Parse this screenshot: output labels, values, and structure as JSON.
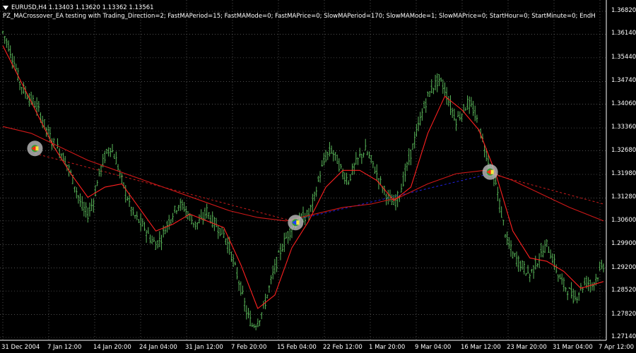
{
  "header": {
    "symbol_line": "EURUSD,H4  1.13403 1.13620 1.13362 1.13561",
    "ea_line": "PZ_MACrossover_EA testing with Trading_Direction=2; FastMAPeriod=15; FastMAMode=0; FastMAPrice=0; SlowMAPeriod=170; SlowMAMode=1; SlowMAPrice=0; StartHour=0; StartMinute=0; EndH"
  },
  "colors": {
    "background": "#000000",
    "grid": "#7f7f7f",
    "candles": "#59b659",
    "fast_ma": "#ff2020",
    "slow_ma": "#d01818",
    "trend_line_down": "#c81c1c",
    "trend_line_up": "#2020e0",
    "text": "#ffffff"
  },
  "chart_data": {
    "type": "candlestick",
    "symbol": "EURUSD",
    "timeframe": "H4",
    "last_ohlc": {
      "open": 1.13403,
      "high": 1.1362,
      "low": 1.13362,
      "close": 1.13561
    },
    "ylim": [
      1.27,
      1.369
    ],
    "y_ticks": [
      "1.36820",
      "1.36140",
      "1.35440",
      "1.34740",
      "1.34060",
      "1.33360",
      "1.32680",
      "1.31980",
      "1.31280",
      "1.30600",
      "1.29900",
      "1.29200",
      "1.28520",
      "1.27820",
      "1.27140"
    ],
    "x_ticks": [
      "31 Dec 2004",
      "7 Jan 12:00",
      "14 Jan 20:00",
      "24 Jan 04:00",
      "31 Jan 12:00",
      "7 Feb 20:00",
      "15 Feb 04:00",
      "22 Feb 12:00",
      "1 Mar 20:00",
      "9 Mar 04:00",
      "16 Mar 12:00",
      "23 Mar 20:00",
      "31 Mar 04:00",
      "7 Apr 12:00"
    ],
    "grid": true,
    "price_path": [
      [
        0,
        1.362
      ],
      [
        3,
        1.358
      ],
      [
        6,
        1.353
      ],
      [
        9,
        1.347
      ],
      [
        12,
        1.344
      ],
      [
        15,
        1.342
      ],
      [
        18,
        1.34
      ],
      [
        21,
        1.336
      ],
      [
        24,
        1.332
      ],
      [
        27,
        1.329
      ],
      [
        30,
        1.327
      ],
      [
        33,
        1.324
      ],
      [
        36,
        1.32
      ],
      [
        39,
        1.315
      ],
      [
        42,
        1.31
      ],
      [
        45,
        1.308
      ],
      [
        48,
        1.312
      ],
      [
        51,
        1.32
      ],
      [
        54,
        1.325
      ],
      [
        57,
        1.328
      ],
      [
        60,
        1.324
      ],
      [
        63,
        1.318
      ],
      [
        66,
        1.313
      ],
      [
        69,
        1.308
      ],
      [
        72,
        1.306
      ],
      [
        75,
        1.304
      ],
      [
        78,
        1.301
      ],
      [
        81,
        1.299
      ],
      [
        84,
        1.301
      ],
      [
        87,
        1.305
      ],
      [
        90,
        1.308
      ],
      [
        93,
        1.311
      ],
      [
        96,
        1.31
      ],
      [
        99,
        1.307
      ],
      [
        102,
        1.305
      ],
      [
        105,
        1.306
      ],
      [
        108,
        1.309
      ],
      [
        111,
        1.306
      ],
      [
        114,
        1.304
      ],
      [
        117,
        1.302
      ],
      [
        120,
        1.298
      ],
      [
        123,
        1.292
      ],
      [
        126,
        1.286
      ],
      [
        129,
        1.279
      ],
      [
        132,
        1.275
      ],
      [
        135,
        1.276
      ],
      [
        138,
        1.28
      ],
      [
        141,
        1.286
      ],
      [
        144,
        1.292
      ],
      [
        147,
        1.297
      ],
      [
        150,
        1.301
      ],
      [
        153,
        1.304
      ],
      [
        156,
        1.306
      ],
      [
        159,
        1.307
      ],
      [
        162,
        1.308
      ],
      [
        165,
        1.313
      ],
      [
        168,
        1.32
      ],
      [
        171,
        1.325
      ],
      [
        174,
        1.327
      ],
      [
        177,
        1.324
      ],
      [
        180,
        1.32
      ],
      [
        183,
        1.318
      ],
      [
        186,
        1.322
      ],
      [
        189,
        1.325
      ],
      [
        192,
        1.327
      ],
      [
        195,
        1.324
      ],
      [
        198,
        1.32
      ],
      [
        201,
        1.316
      ],
      [
        204,
        1.313
      ],
      [
        207,
        1.311
      ],
      [
        210,
        1.314
      ],
      [
        213,
        1.32
      ],
      [
        216,
        1.326
      ],
      [
        219,
        1.332
      ],
      [
        222,
        1.338
      ],
      [
        225,
        1.343
      ],
      [
        228,
        1.346
      ],
      [
        231,
        1.348
      ],
      [
        234,
        1.345
      ],
      [
        237,
        1.34
      ],
      [
        240,
        1.336
      ],
      [
        243,
        1.338
      ],
      [
        246,
        1.341
      ],
      [
        249,
        1.339
      ],
      [
        252,
        1.334
      ],
      [
        255,
        1.328
      ],
      [
        258,
        1.322
      ],
      [
        261,
        1.317
      ],
      [
        264,
        1.308
      ],
      [
        267,
        1.3
      ],
      [
        270,
        1.296
      ],
      [
        273,
        1.294
      ],
      [
        276,
        1.292
      ],
      [
        279,
        1.29
      ],
      [
        282,
        1.293
      ],
      [
        285,
        1.296
      ],
      [
        288,
        1.299
      ],
      [
        291,
        1.295
      ],
      [
        294,
        1.29
      ],
      [
        297,
        1.287
      ],
      [
        300,
        1.285
      ],
      [
        303,
        1.283
      ],
      [
        306,
        1.286
      ],
      [
        309,
        1.288
      ],
      [
        312,
        1.287
      ],
      [
        315,
        1.29
      ],
      [
        318,
        1.293
      ]
    ],
    "fast_ma_path": [
      [
        0,
        1.358
      ],
      [
        9,
        1.348
      ],
      [
        18,
        1.338
      ],
      [
        27,
        1.328
      ],
      [
        36,
        1.32
      ],
      [
        45,
        1.313
      ],
      [
        54,
        1.316
      ],
      [
        63,
        1.317
      ],
      [
        72,
        1.31
      ],
      [
        81,
        1.303
      ],
      [
        90,
        1.305
      ],
      [
        99,
        1.308
      ],
      [
        108,
        1.306
      ],
      [
        117,
        1.304
      ],
      [
        126,
        1.293
      ],
      [
        135,
        1.28
      ],
      [
        144,
        1.284
      ],
      [
        153,
        1.298
      ],
      [
        162,
        1.306
      ],
      [
        171,
        1.316
      ],
      [
        180,
        1.321
      ],
      [
        189,
        1.321
      ],
      [
        198,
        1.318
      ],
      [
        207,
        1.312
      ],
      [
        216,
        1.316
      ],
      [
        225,
        1.332
      ],
      [
        234,
        1.343
      ],
      [
        243,
        1.339
      ],
      [
        252,
        1.333
      ],
      [
        261,
        1.32
      ],
      [
        270,
        1.303
      ],
      [
        279,
        1.295
      ],
      [
        288,
        1.294
      ],
      [
        297,
        1.291
      ],
      [
        306,
        1.286
      ],
      [
        318,
        1.288
      ]
    ],
    "slow_ma_path": [
      [
        0,
        1.334
      ],
      [
        15,
        1.332
      ],
      [
        30,
        1.328
      ],
      [
        45,
        1.324
      ],
      [
        60,
        1.321
      ],
      [
        75,
        1.318
      ],
      [
        90,
        1.315
      ],
      [
        105,
        1.312
      ],
      [
        120,
        1.309
      ],
      [
        135,
        1.307
      ],
      [
        150,
        1.306
      ],
      [
        165,
        1.308
      ],
      [
        180,
        1.31
      ],
      [
        195,
        1.311
      ],
      [
        210,
        1.313
      ],
      [
        225,
        1.317
      ],
      [
        240,
        1.32
      ],
      [
        255,
        1.321
      ],
      [
        270,
        1.318
      ],
      [
        285,
        1.314
      ],
      [
        300,
        1.31
      ],
      [
        318,
        1.306
      ]
    ],
    "trend_lines": [
      {
        "direction": "down",
        "from": [
          17,
          1.326
        ],
        "to": [
          153,
          1.306
        ]
      },
      {
        "direction": "up",
        "from": [
          153,
          1.306
        ],
        "to": [
          258,
          1.32
        ]
      },
      {
        "direction": "down",
        "from": [
          258,
          1.32
        ],
        "to": [
          318,
          1.311
        ]
      }
    ],
    "signals": [
      {
        "type": "sell",
        "at": [
          17,
          1.3275
        ]
      },
      {
        "type": "buy",
        "at": [
          155,
          1.3055
        ]
      },
      {
        "type": "sell",
        "at": [
          258,
          1.3205
        ]
      }
    ]
  }
}
